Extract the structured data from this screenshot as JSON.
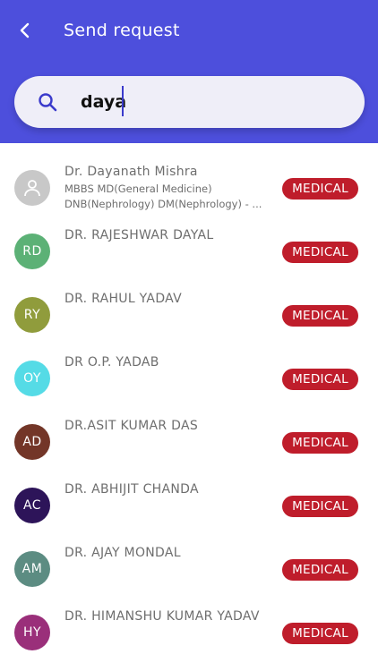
{
  "header": {
    "title": "Send request",
    "background": "#4d4fdc"
  },
  "search": {
    "value": "daya",
    "icon": "search-icon"
  },
  "badge_color": "#bf1d2b",
  "doctors": [
    {
      "name": "Dr. Dayanath Mishra",
      "initials": "",
      "avatar_color": "#c8c8c8",
      "qualification_line1": "MBBS MD(General Medicine)",
      "qualification_line2": "DNB(Nephrology) DM(Nephrology) - ...",
      "badge": "MEDICAL"
    },
    {
      "name": "DR. RAJESHWAR DAYAL",
      "initials": "RD",
      "avatar_color": "#5cb176",
      "badge": "MEDICAL"
    },
    {
      "name": "DR. RAHUL YADAV",
      "initials": "RY",
      "avatar_color": "#909c3c",
      "badge": "MEDICAL"
    },
    {
      "name": "DR O.P. YADAB",
      "initials": "OY",
      "avatar_color": "#55dbe6",
      "badge": "MEDICAL"
    },
    {
      "name": "DR.ASIT KUMAR DAS",
      "initials": "AD",
      "avatar_color": "#733628",
      "badge": "MEDICAL"
    },
    {
      "name": "DR. ABHIJIT CHANDA",
      "initials": "AC",
      "avatar_color": "#2d1459",
      "badge": "MEDICAL"
    },
    {
      "name": "DR. AJAY MONDAL",
      "initials": "AM",
      "avatar_color": "#5c8c82",
      "badge": "MEDICAL"
    },
    {
      "name": "DR. HIMANSHU KUMAR YADAV",
      "initials": "HY",
      "avatar_color": "#9a2f7a",
      "badge": "MEDICAL"
    }
  ]
}
